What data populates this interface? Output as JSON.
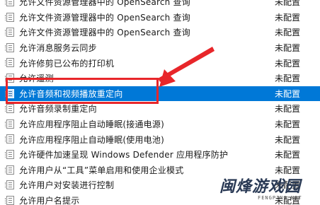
{
  "policy_list": {
    "rows": [
      {
        "name": "允许文件资源管理器中的 OpenSearch 查询",
        "state": "未配置"
      },
      {
        "name": "允许文件资源管理器中的 OpenSearch 查询",
        "state": "未配置"
      },
      {
        "name": "允许文件资源管理器中的 OpenSearch 查询",
        "state": "未配置"
      },
      {
        "name": "允许消息服务云同步",
        "state": "未配置"
      },
      {
        "name": "允许修剪已公布的打印机",
        "state": "未配置"
      },
      {
        "name": "允许遥测",
        "state": "未配置"
      },
      {
        "name": "允许音频和视频播放重定向",
        "state": "未配置"
      },
      {
        "name": "允许音频录制重定向",
        "state": "未配置"
      },
      {
        "name": "允许应用程序阻止自动睡眠(接通电源)",
        "state": "未配置"
      },
      {
        "name": "允许应用程序阻止自动睡眠(使用电池)",
        "state": "未配置"
      },
      {
        "name": "允许硬件加速呈现 Windows Defender 应用程序防护",
        "state": "未配置"
      },
      {
        "name": "允许用户从“工具”菜单启用和使用企业模式",
        "state": "未配置"
      },
      {
        "name": "允许用户对安装进行控制",
        "state": "未配置"
      },
      {
        "name": "允许用户名提示",
        "state": "未配置"
      }
    ],
    "selected_index": 6
  },
  "watermark": {
    "main": "闽烽游戏园",
    "sub": "FENGPING.NET"
  },
  "colors": {
    "selection": "#0078d7",
    "highlight_box": "#e8262a"
  }
}
